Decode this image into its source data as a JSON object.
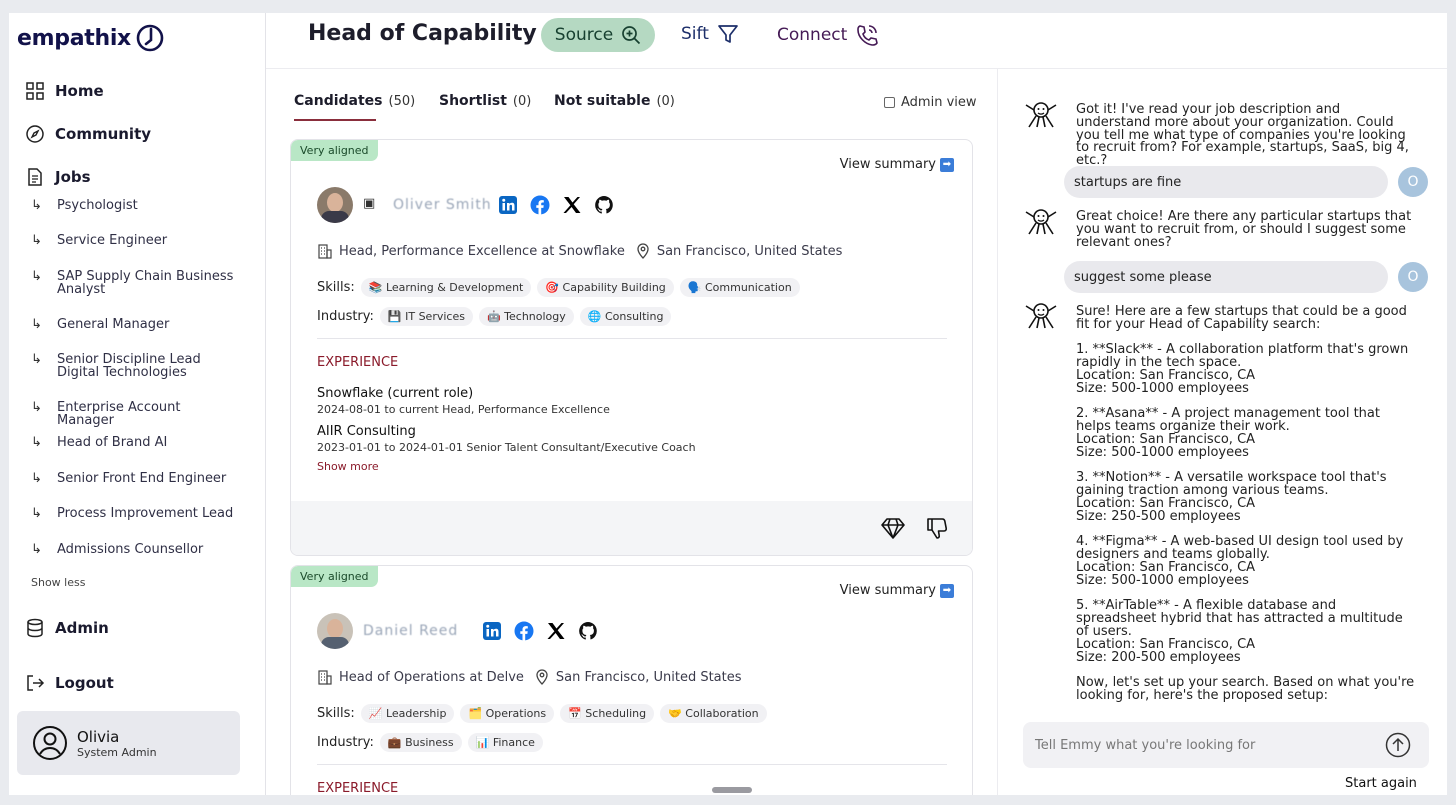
{
  "app": {
    "logo_text": "empathix"
  },
  "sidebar": {
    "nav": {
      "home": "Home",
      "community": "Community",
      "jobs": "Jobs",
      "admin": "Admin",
      "logout": "Logout"
    },
    "jobs": [
      {
        "label": "Psychologist"
      },
      {
        "label": "Service Engineer"
      },
      {
        "label": "SAP Supply Chain Business Analyst"
      },
      {
        "label": "General Manager"
      },
      {
        "label": "Senior Discipline Lead Digital Technologies"
      },
      {
        "label": "Enterprise Account Manager"
      },
      {
        "label": "Head of Brand AI"
      },
      {
        "label": "Senior Front End Engineer"
      },
      {
        "label": "Process Improvement Lead"
      },
      {
        "label": "Admissions Counsellor"
      }
    ],
    "show_less": "Show less",
    "user": {
      "name": "Olivia",
      "role": "System Admin"
    }
  },
  "header": {
    "job_title": "Head of Capability",
    "tabs": {
      "source": "Source",
      "sift": "Sift",
      "connect": "Connect"
    }
  },
  "candidate_tabs": {
    "candidates": {
      "label": "Candidates",
      "count": "(50)"
    },
    "shortlist": {
      "label": "Shortlist",
      "count": "(0)"
    },
    "not_suitable": {
      "label": "Not suitable",
      "count": "(0)"
    },
    "admin_view": "Admin view"
  },
  "cards": [
    {
      "badge": "Very aligned",
      "view_summary": "View summary",
      "name": "Oliver Smith",
      "role": "Head, Performance Excellence at Snowflake",
      "location": "San Francisco, United States",
      "skills_label": "Skills:",
      "skills": [
        "📚 Learning & Development",
        "🎯 Capability Building",
        "🗣️ Communication"
      ],
      "industry_label": "Industry:",
      "industries": [
        "💾 IT Services",
        "🤖 Technology",
        "🌐 Consulting"
      ],
      "experience_heading": "EXPERIENCE",
      "experience": [
        {
          "company": "Snowflake  (current role)",
          "dates": "2024-08-01 to current   Head, Performance Excellence"
        },
        {
          "company": "AIIR Consulting",
          "dates": "2023-01-01 to 2024-01-01   Senior Talent Consultant/Executive Coach"
        }
      ],
      "show_more": "Show more"
    },
    {
      "badge": "Very aligned",
      "view_summary": "View summary",
      "name": "Daniel Reed",
      "role": "Head of Operations at Delve",
      "location": "San Francisco, United States",
      "skills_label": "Skills:",
      "skills": [
        "📈 Leadership",
        "🗂️ Operations",
        "📅 Scheduling",
        "🤝 Collaboration"
      ],
      "industry_label": "Industry:",
      "industries": [
        "💼 Business",
        "📊 Finance"
      ],
      "experience_heading": "EXPERIENCE"
    }
  ],
  "chat": {
    "messages": [
      {
        "from": "bot",
        "text": "Got it! I've read your job description and understand more about your organization. Could you tell me what type of companies you're looking to recruit from? For example, startups, SaaS, big 4, etc.?"
      },
      {
        "from": "user",
        "text": "startups are fine",
        "initial": "O"
      },
      {
        "from": "bot",
        "text": "Great choice! Are there any particular startups that you want to recruit from, or should I suggest some relevant ones?"
      },
      {
        "from": "user",
        "text": "suggest some please",
        "initial": "O"
      },
      {
        "from": "bot",
        "text": "Sure! Here are a few startups that could be a good fit for your Head of Capability search:\n\n1. **Slack** - A collaboration platform that's grown rapidly in the tech space.\n   Location: San Francisco, CA\n   Size: 500-1000 employees\n\n2. **Asana** - A project management tool that helps teams organize their work.\n   Location: San Francisco, CA\n   Size: 500-1000 employees\n\n3. **Notion** - A versatile workspace tool that's gaining traction among various teams.\n   Location: San Francisco, CA\n   Size: 250-500 employees\n\n4. **Figma** - A web-based UI design tool used by designers and teams globally.\n   Location: San Francisco, CA\n   Size: 500-1000 employees\n\n5. **AirTable** - A flexible database and spreadsheet hybrid that has attracted a multitude of users.\n   Location: San Francisco, CA\n   Size: 200-500 employees\n\nNow, let's set up your search. Based on what you're looking for, here's the proposed setup:"
      }
    ],
    "input_placeholder": "Tell Emmy what you're looking for",
    "start_again": "Start again"
  },
  "colors": {
    "accent_green": "#b5d9c2",
    "badge_green": "#b9e7c6",
    "experience_red": "#8a1a2a",
    "linkedin": "#0a66c2",
    "facebook": "#1877f2"
  },
  "icons": [
    "logo-icon",
    "home-icon",
    "community-icon",
    "jobs-icon",
    "subitem-arrow-icon",
    "admin-icon",
    "logout-icon",
    "user-icon",
    "search-plus-icon",
    "filter-icon",
    "phone-icon",
    "linkedin-icon",
    "facebook-icon",
    "x-icon",
    "github-icon",
    "building-icon",
    "location-icon",
    "diamond-icon",
    "thumbs-down-icon",
    "bot-icon",
    "send-icon"
  ]
}
